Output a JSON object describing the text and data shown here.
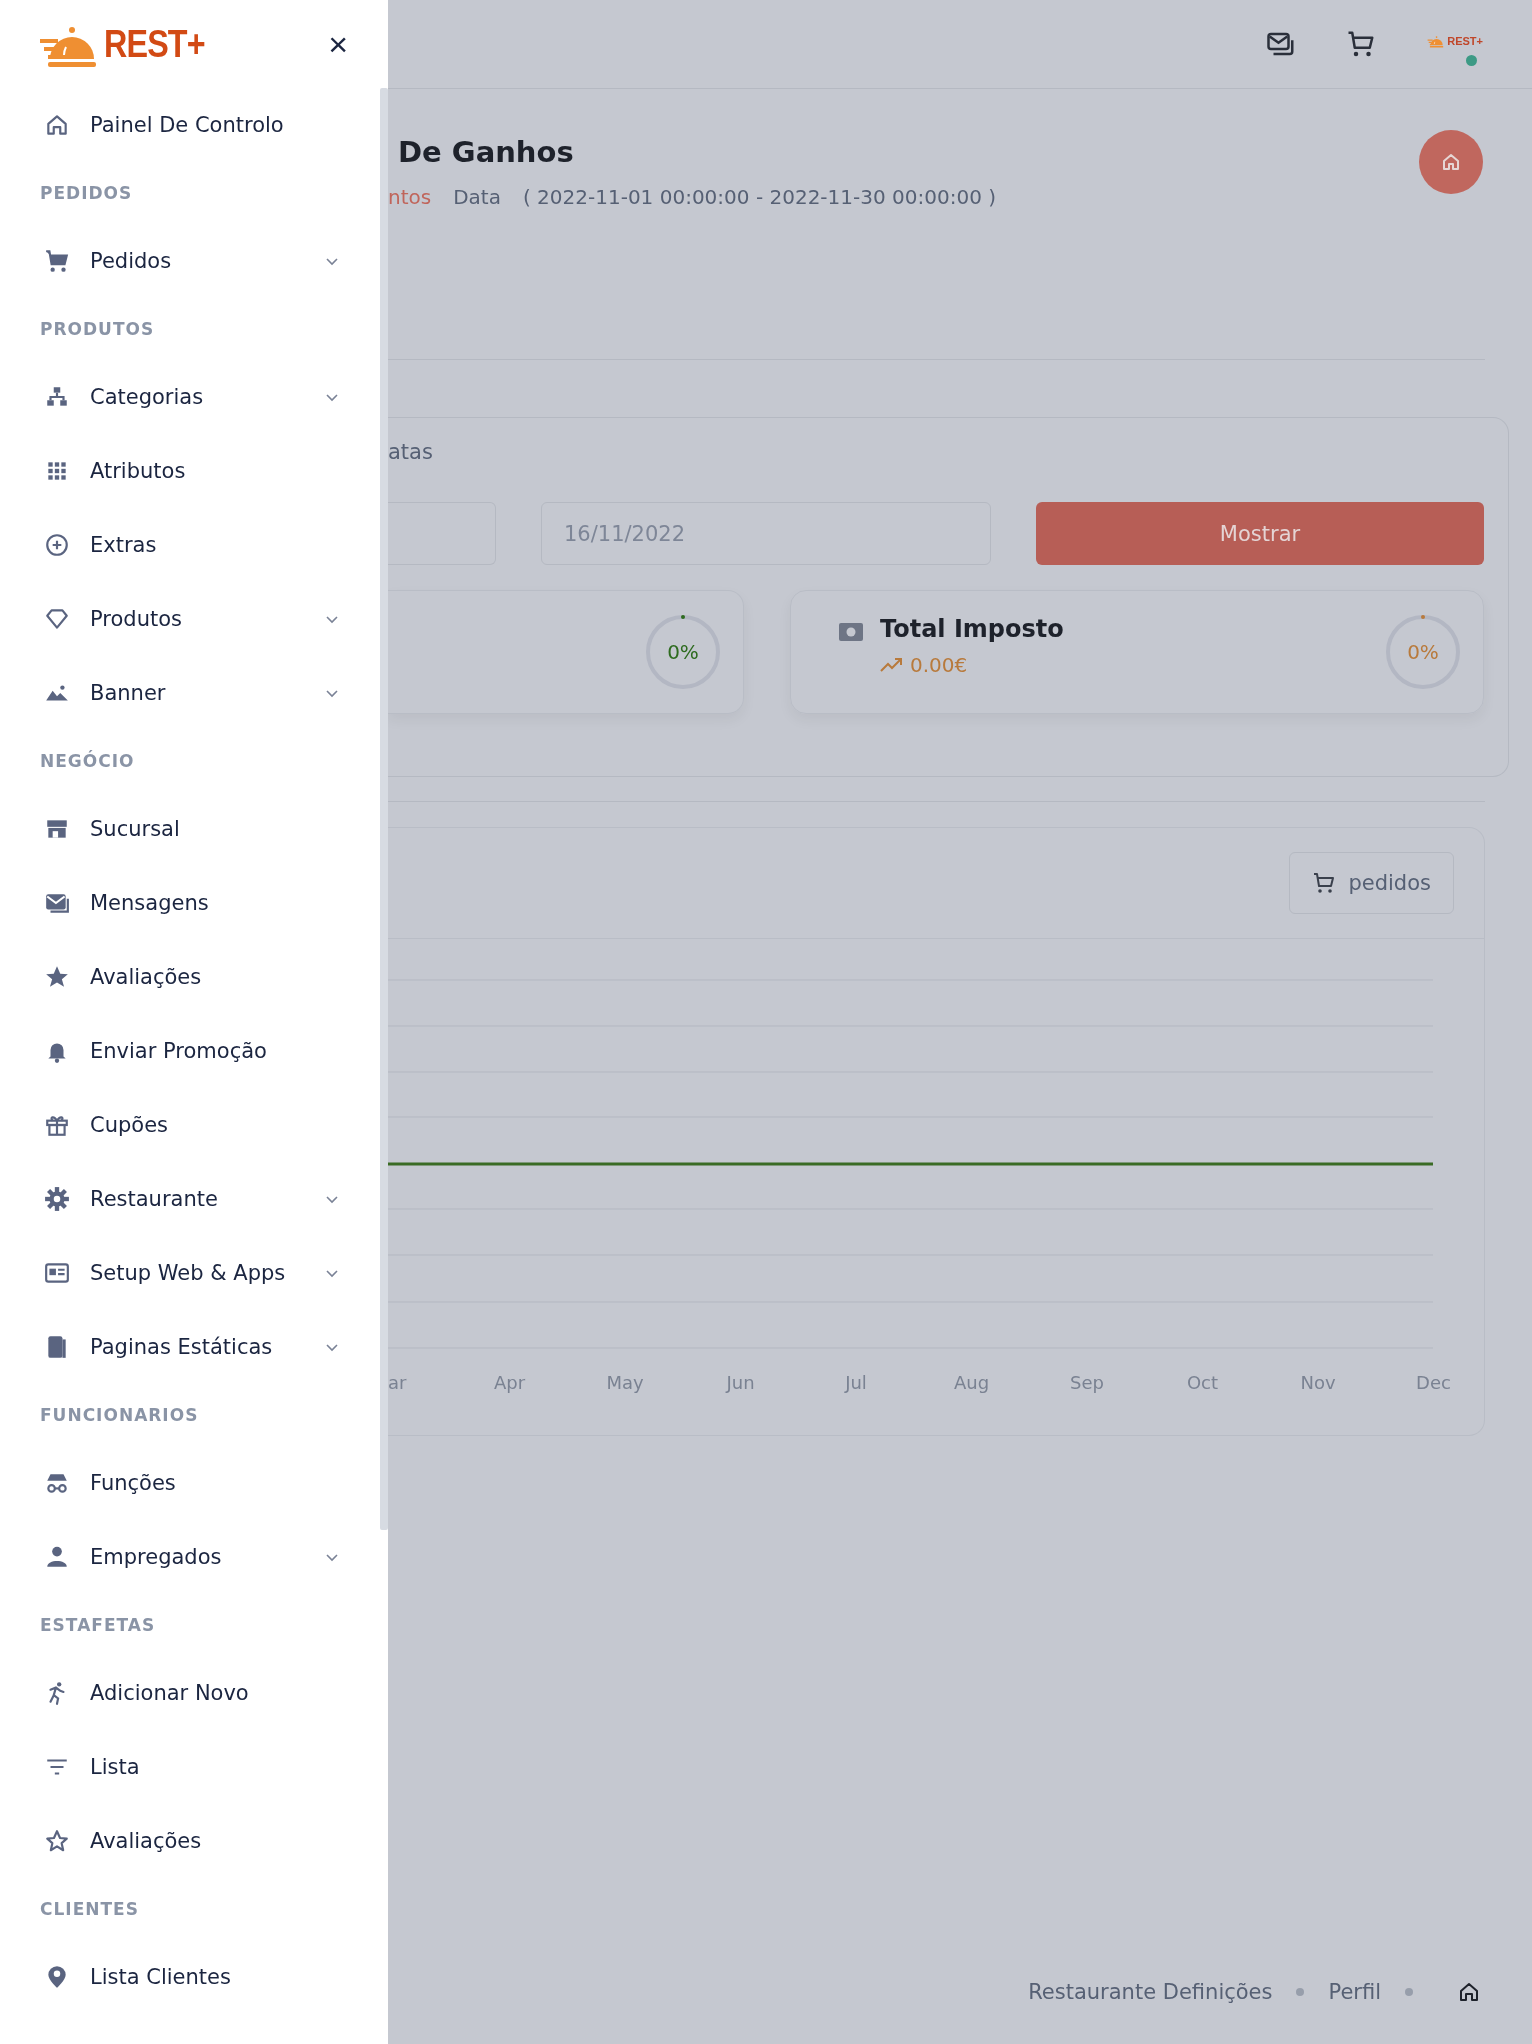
{
  "sidebar": {
    "logo": "REST+",
    "close": "×",
    "groups": [
      {
        "items": [
          {
            "label": "Painel De Controlo",
            "has_submenu": false
          }
        ]
      },
      {
        "heading": "PEDIDOS",
        "items": [
          {
            "label": "Pedidos",
            "has_submenu": true
          }
        ]
      },
      {
        "heading": "PRODUTOS",
        "items": [
          {
            "label": "Categorias",
            "has_submenu": true
          },
          {
            "label": "Atributos",
            "has_submenu": false
          },
          {
            "label": "Extras",
            "has_submenu": false
          },
          {
            "label": "Produtos",
            "has_submenu": true
          },
          {
            "label": "Banner",
            "has_submenu": true
          }
        ]
      },
      {
        "heading": "NEGÓCIO",
        "items": [
          {
            "label": "Sucursal",
            "has_submenu": false
          },
          {
            "label": "Mensagens",
            "has_submenu": false
          },
          {
            "label": "Avaliações",
            "has_submenu": false
          },
          {
            "label": "Enviar Promoção",
            "has_submenu": false
          },
          {
            "label": "Cupões",
            "has_submenu": false
          },
          {
            "label": "Restaurante",
            "has_submenu": true
          },
          {
            "label": "Setup Web & Apps",
            "has_submenu": true
          },
          {
            "label": "Paginas Estáticas",
            "has_submenu": true
          }
        ]
      },
      {
        "heading": "FUNCIONARIOS",
        "items": [
          {
            "label": "Funções",
            "has_submenu": false
          },
          {
            "label": "Empregados",
            "has_submenu": true
          }
        ]
      },
      {
        "heading": "ESTAFETAS",
        "items": [
          {
            "label": "Adicionar Novo",
            "has_submenu": false
          },
          {
            "label": "Lista",
            "has_submenu": false
          },
          {
            "label": "Avaliações",
            "has_submenu": false
          }
        ]
      },
      {
        "heading": "CLIENTES",
        "items": [
          {
            "label": "Lista Clientes",
            "has_submenu": false
          }
        ]
      }
    ]
  },
  "topbar": {
    "logo": "REST+",
    "online": true
  },
  "header": {
    "title": "De Ganhos",
    "breadcrumb": "ntos",
    "date_label": "Data",
    "date_range": "( 2022-11-01 00:00:00 - 2022-11-30 00:00:00 )"
  },
  "filter": {
    "label": "atas",
    "date_to": "16/11/2022",
    "button": "Mostrar"
  },
  "stats": [
    {
      "percent": "0%",
      "level": 0,
      "color": "#2e6b1f"
    },
    {
      "title": "Total Imposto",
      "amount": "0.00€",
      "percent": "0%",
      "level": 0,
      "color": "#b87a3c"
    }
  ],
  "chart": {
    "button": "pedidos",
    "x_labels": [
      "ar",
      "Apr",
      "May",
      "Jun",
      "Jul",
      "Aug",
      "Sep",
      "Oct",
      "Nov",
      "Dec"
    ]
  },
  "footer": {
    "links": [
      "Restaurante Definições",
      "Perfil"
    ]
  }
}
